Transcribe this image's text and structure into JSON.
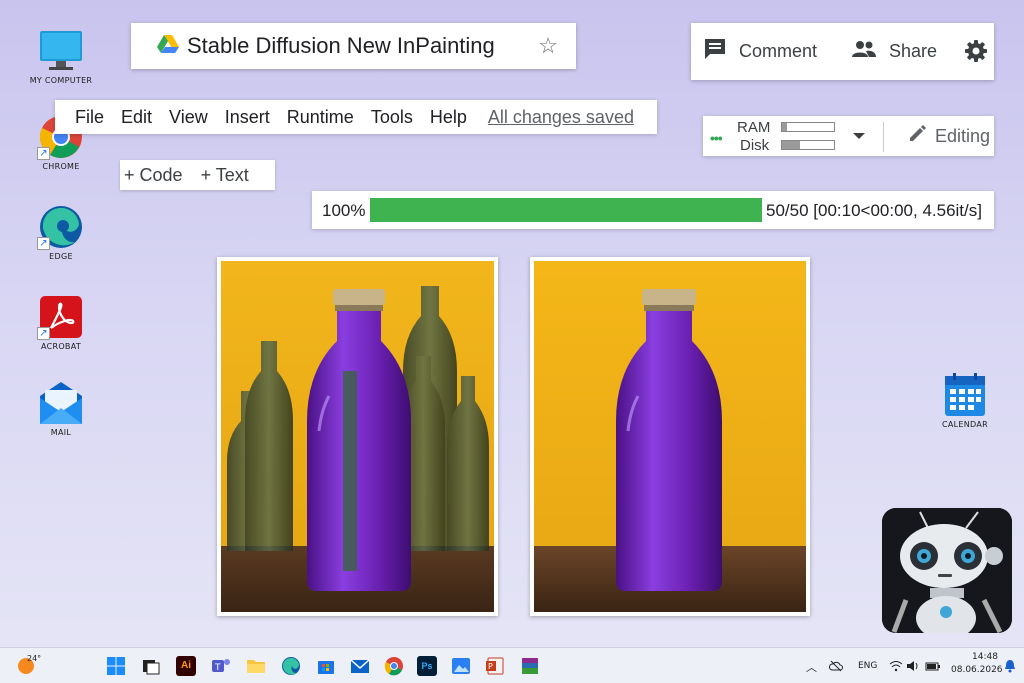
{
  "desktop": {
    "icons": [
      {
        "label": "MY COMPUTER",
        "icon": "monitor-icon"
      },
      {
        "label": "CHROME",
        "icon": "chrome-icon"
      },
      {
        "label": "EDGE",
        "icon": "edge-icon"
      },
      {
        "label": "ACROBAT",
        "icon": "acrobat-icon"
      },
      {
        "label": "MAIL",
        "icon": "mail-icon"
      },
      {
        "label": "CALENDAR",
        "icon": "calendar-icon"
      }
    ]
  },
  "notebook": {
    "title": "Stable Diffusion New InPainting",
    "comment_label": "Comment",
    "share_label": "Share",
    "menu": [
      "File",
      "Edit",
      "View",
      "Insert",
      "Runtime",
      "Tools",
      "Help"
    ],
    "save_status": "All changes saved",
    "add_code_label": "Code",
    "add_text_label": "Text",
    "ram_label": "RAM",
    "disk_label": "Disk",
    "ram_usage": 0.1,
    "disk_usage": 0.35,
    "editing_label": "Editing"
  },
  "progress": {
    "percent_label": "100%",
    "fraction": 1.0,
    "stats": "50/50 [00:10<00:00, 4.56it/s]"
  },
  "images": [
    {
      "alt": "original bottle photo"
    },
    {
      "alt": "inpainted bottle photo"
    }
  ],
  "taskbar": {
    "weather": "24°",
    "language": "ENG",
    "time": "14:48",
    "date": "08.06.2026"
  },
  "colors": {
    "accent_green": "#3fb34f",
    "background": "#d8d6f3",
    "bottle_purple": "#6a1fb0",
    "wall_yellow": "#f0b417"
  }
}
